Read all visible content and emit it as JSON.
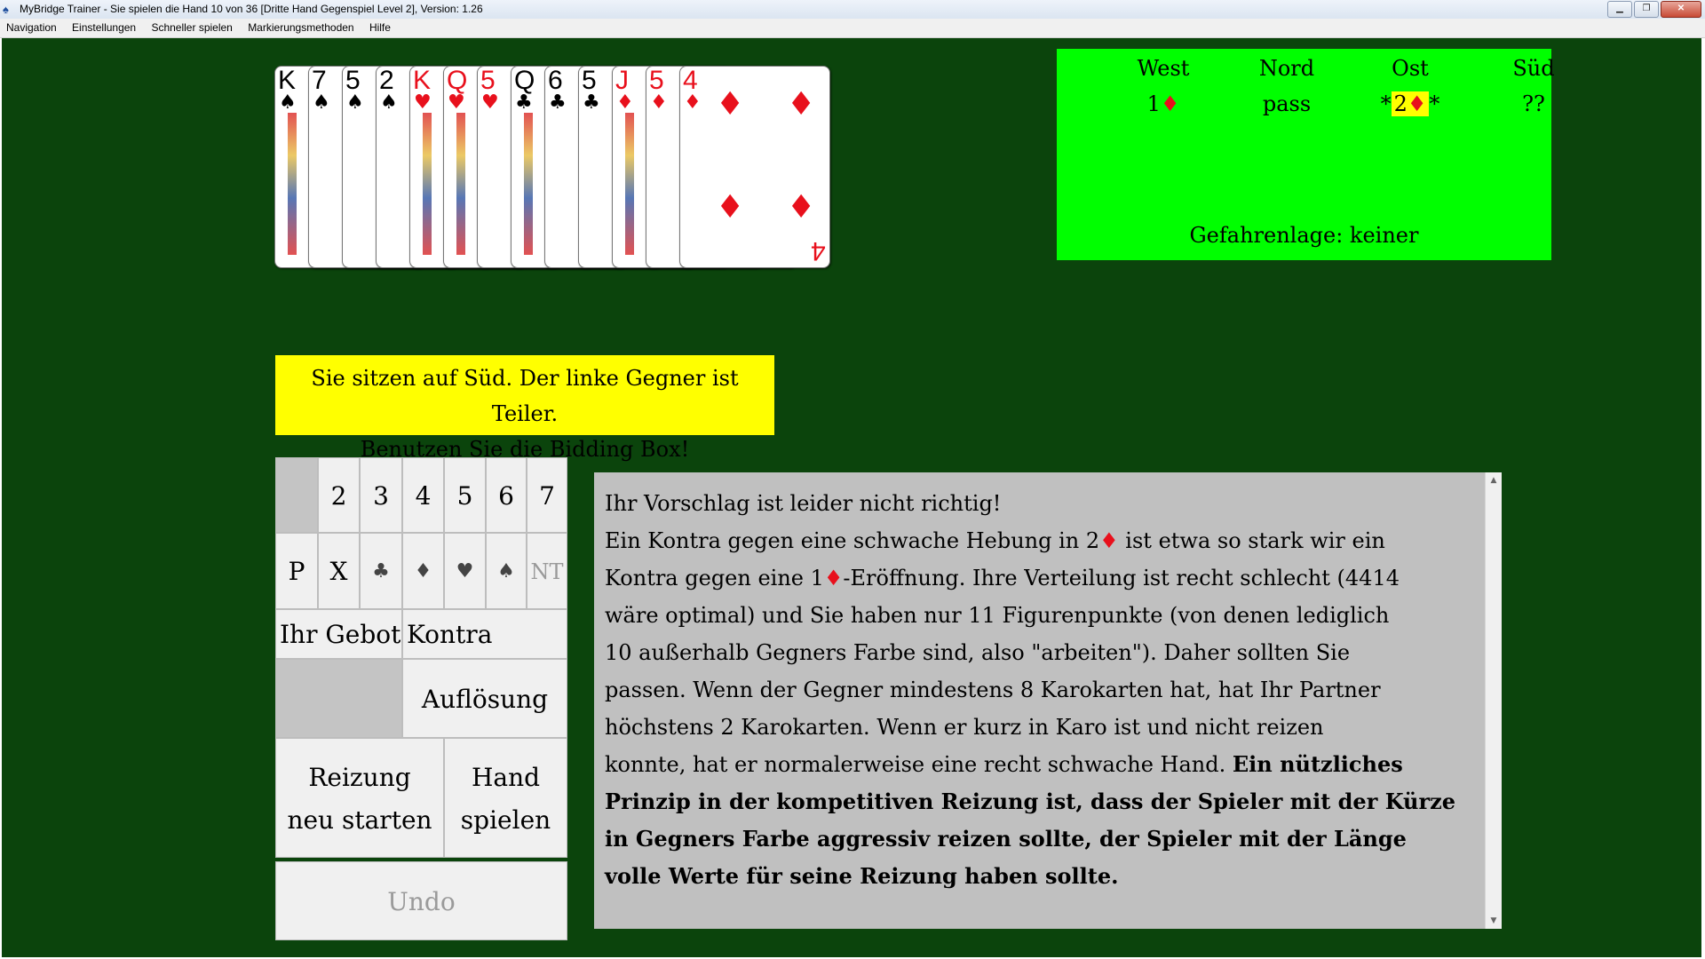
{
  "window": {
    "title": "MyBridge Trainer - Sie spielen die Hand 10 von 36 [Dritte Hand Gegenspiel Level 2], Version: 1.26"
  },
  "menu": [
    "Navigation",
    "Einstellungen",
    "Schneller spielen",
    "Markierungsmethoden",
    "Hilfe"
  ],
  "hand": [
    {
      "rank": "K",
      "suit": "♠",
      "color": "black"
    },
    {
      "rank": "7",
      "suit": "♠",
      "color": "black"
    },
    {
      "rank": "5",
      "suit": "♠",
      "color": "black"
    },
    {
      "rank": "2",
      "suit": "♠",
      "color": "black"
    },
    {
      "rank": "K",
      "suit": "♥",
      "color": "red"
    },
    {
      "rank": "Q",
      "suit": "♥",
      "color": "red"
    },
    {
      "rank": "5",
      "suit": "♥",
      "color": "red"
    },
    {
      "rank": "Q",
      "suit": "♣",
      "color": "black"
    },
    {
      "rank": "6",
      "suit": "♣",
      "color": "black"
    },
    {
      "rank": "5",
      "suit": "♣",
      "color": "black"
    },
    {
      "rank": "J",
      "suit": "♦",
      "color": "red"
    },
    {
      "rank": "5",
      "suit": "♦",
      "color": "red"
    },
    {
      "rank": "4",
      "suit": "♦",
      "color": "red"
    }
  ],
  "auction": {
    "headers": [
      "West",
      "Nord",
      "Ost",
      "Süd"
    ],
    "bids": [
      {
        "pre": "",
        "text": "1",
        "suit": "♦",
        "post": "",
        "highlight": false
      },
      {
        "pre": "",
        "text": "pass",
        "suit": "",
        "post": "",
        "highlight": false
      },
      {
        "pre": "*",
        "text": "2",
        "suit": "♦",
        "post": "*",
        "highlight": true
      },
      {
        "pre": "",
        "text": "??",
        "suit": "",
        "post": "",
        "highlight": false
      }
    ],
    "vulnerability": "Gefahrenlage: keiner",
    "bg_color": "#00ff00"
  },
  "instructions": {
    "line1": "Sie sitzen auf Süd. Der linke Gegner ist Teiler.",
    "line2": "Benutzen Sie die Bidding Box!"
  },
  "bidding_box": {
    "levels": [
      "2",
      "3",
      "4",
      "5",
      "6",
      "7"
    ],
    "calls": [
      {
        "label": "P",
        "name": "pass-button",
        "size": 28,
        "disabled": false
      },
      {
        "label": "X",
        "name": "double-button",
        "size": 28,
        "disabled": false
      },
      {
        "label": "♣",
        "name": "clubs-button",
        "size": 22,
        "disabled": false
      },
      {
        "label": "♦",
        "name": "diamonds-button",
        "size": 22,
        "disabled": false
      },
      {
        "label": "♥",
        "name": "hearts-button",
        "size": 22,
        "disabled": false
      },
      {
        "label": "♠",
        "name": "spades-button",
        "size": 22,
        "disabled": false
      },
      {
        "label": "NT",
        "name": "notrump-button",
        "size": 24,
        "disabled": true
      }
    ],
    "your_bid_label": "Ihr Gebot",
    "your_bid_value": "Kontra",
    "solution_label": "Auflösung",
    "restart_line1": "Reizung",
    "restart_line2": "neu starten",
    "play_line1": "Hand",
    "play_line2": "spielen",
    "undo_label": "Undo"
  },
  "explanation": {
    "l1": "Ihr Vorschlag ist leider nicht richtig!",
    "l2a": "Ein Kontra gegen eine schwache Hebung in 2",
    "l2b": " ist etwa so stark wir ein",
    "l3a": "Kontra gegen eine 1",
    "l3b": "-Eröffnung. Ihre Verteilung ist recht schlecht (4414",
    "l4": "wäre optimal) und Sie haben nur 11 Figurenpunkte (von denen lediglich",
    "l5": "10 außerhalb Gegners Farbe sind, also \"arbeiten\"). Daher sollten Sie",
    "l6": "passen. Wenn der Gegner mindestens 8 Karokarten hat, hat Ihr Partner",
    "l7": "höchstens 2 Karokarten. Wenn er kurz in Karo ist und nicht reizen",
    "l8a": "konnte, hat er normalerweise eine recht schwache Hand. ",
    "l8b": "Ein nützliches",
    "l9": "Prinzip in der kompetitiven Reizung ist, dass der Spieler mit der Kürze",
    "l10": "in Gegners Farbe aggressiv reizen sollte, der Spieler mit der Länge",
    "l11": "volle Werte für seine Reizung haben sollte.",
    "diamond": "♦"
  },
  "colors": {
    "felt": "#0b440c",
    "instructions_bg": "#ffff00",
    "explanation_bg": "#c0c0c0",
    "diamond_red": "#e8101c"
  }
}
